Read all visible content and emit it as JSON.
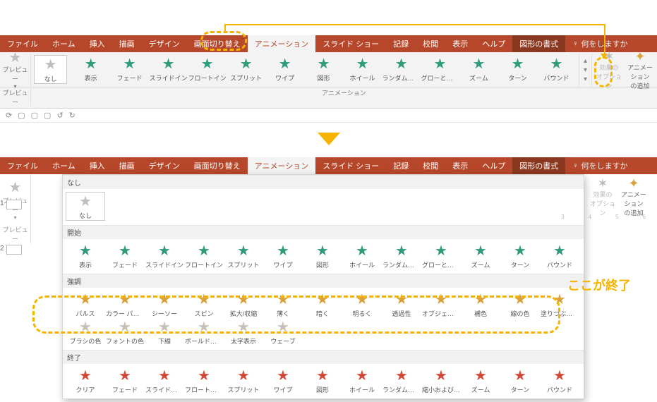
{
  "ribbon": {
    "tabs": [
      "ファイル",
      "ホーム",
      "挿入",
      "描画",
      "デザイン",
      "画面切り替え",
      "アニメーション",
      "スライド ショー",
      "記録",
      "校閲",
      "表示",
      "ヘルプ"
    ],
    "contextTab": "図形の書式",
    "tellMe": "何をしますか",
    "activeTab": "アニメーション"
  },
  "preview": {
    "label": "プレビュー",
    "groupLabel": "プレビュー"
  },
  "none": {
    "label": "なし"
  },
  "galleryTop": [
    {
      "label": "表示",
      "cls": "c-green"
    },
    {
      "label": "フェード",
      "cls": "c-green"
    },
    {
      "label": "スライドイン",
      "cls": "c-green"
    },
    {
      "label": "フロートイン",
      "cls": "c-green"
    },
    {
      "label": "スプリット",
      "cls": "c-green"
    },
    {
      "label": "ワイプ",
      "cls": "c-green"
    },
    {
      "label": "図形",
      "cls": "c-green"
    },
    {
      "label": "ホイール",
      "cls": "c-green"
    },
    {
      "label": "ランダムスト…",
      "cls": "c-green"
    },
    {
      "label": "グローとターン",
      "cls": "c-green"
    },
    {
      "label": "ズーム",
      "cls": "c-green"
    },
    {
      "label": "ターン",
      "cls": "c-green"
    },
    {
      "label": "バウンド",
      "cls": "c-green"
    }
  ],
  "groupCaption": "アニメーション",
  "rightGroup": {
    "options": "効果の\nオプション",
    "add": "アニメーション\nの追加"
  },
  "quick": [
    "⟳",
    "▢",
    "▢",
    "▢",
    "↺",
    "↻"
  ],
  "expanded": {
    "sections": [
      {
        "title": "なし",
        "items": [
          {
            "label": "なし",
            "cls": "c-none"
          }
        ]
      },
      {
        "title": "開始",
        "items": [
          {
            "label": "表示",
            "cls": "c-green"
          },
          {
            "label": "フェード",
            "cls": "c-green"
          },
          {
            "label": "スライドイン",
            "cls": "c-green"
          },
          {
            "label": "フロートイン",
            "cls": "c-green"
          },
          {
            "label": "スプリット",
            "cls": "c-green"
          },
          {
            "label": "ワイプ",
            "cls": "c-green"
          },
          {
            "label": "図形",
            "cls": "c-green"
          },
          {
            "label": "ホイール",
            "cls": "c-green"
          },
          {
            "label": "ランダムスト…",
            "cls": "c-green"
          },
          {
            "label": "グローとターン",
            "cls": "c-green"
          },
          {
            "label": "ズーム",
            "cls": "c-green"
          },
          {
            "label": "ターン",
            "cls": "c-green"
          },
          {
            "label": "バウンド",
            "cls": "c-green"
          }
        ]
      },
      {
        "title": "強調",
        "items": [
          {
            "label": "パルス",
            "cls": "c-amber"
          },
          {
            "label": "カラー パルス",
            "cls": "c-amber"
          },
          {
            "label": "シーソー",
            "cls": "c-amber"
          },
          {
            "label": "スピン",
            "cls": "c-amber"
          },
          {
            "label": "拡大/収縮",
            "cls": "c-amber"
          },
          {
            "label": "薄く",
            "cls": "c-amber"
          },
          {
            "label": "暗く",
            "cls": "c-amber"
          },
          {
            "label": "明るく",
            "cls": "c-amber"
          },
          {
            "label": "透過性",
            "cls": "c-amber"
          },
          {
            "label": "オブジェクト …",
            "cls": "c-amber"
          },
          {
            "label": "補色",
            "cls": "c-amber"
          },
          {
            "label": "線の色",
            "cls": "c-amber"
          },
          {
            "label": "塗りつぶしの色",
            "cls": "c-amber"
          },
          {
            "label": "ブラシの色",
            "cls": "c-amber-dim"
          },
          {
            "label": "フォントの色",
            "cls": "c-amber-dim"
          },
          {
            "label": "下線",
            "cls": "c-amber-dim"
          },
          {
            "label": "ボールドフラ…",
            "cls": "c-amber-dim"
          },
          {
            "label": "太字表示",
            "cls": "c-amber-dim"
          },
          {
            "label": "ウェーブ",
            "cls": "c-amber-dim"
          }
        ]
      },
      {
        "title": "終了",
        "items": [
          {
            "label": "クリア",
            "cls": "c-red"
          },
          {
            "label": "フェード",
            "cls": "c-red"
          },
          {
            "label": "スライドアウト",
            "cls": "c-red"
          },
          {
            "label": "フロートアウト",
            "cls": "c-red"
          },
          {
            "label": "スプリット",
            "cls": "c-red"
          },
          {
            "label": "ワイプ",
            "cls": "c-red"
          },
          {
            "label": "図形",
            "cls": "c-red"
          },
          {
            "label": "ホイール",
            "cls": "c-red"
          },
          {
            "label": "ランダムスト…",
            "cls": "c-red"
          },
          {
            "label": "縮小および…",
            "cls": "c-red"
          },
          {
            "label": "ズーム",
            "cls": "c-red"
          },
          {
            "label": "ターン",
            "cls": "c-red"
          },
          {
            "label": "バウンド",
            "cls": "c-red"
          }
        ]
      }
    ]
  },
  "callout": "ここが終了",
  "slides": [
    "1",
    "2"
  ],
  "rulerNums": [
    "3",
    "4",
    "5",
    "6"
  ]
}
